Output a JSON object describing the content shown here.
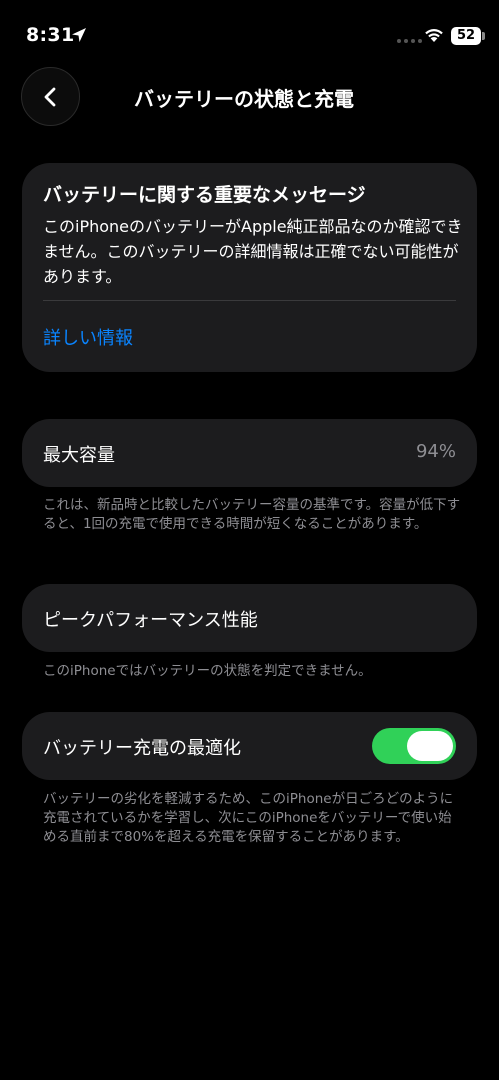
{
  "status_bar": {
    "time": "8:31",
    "battery_level": "52",
    "icons": [
      "location-arrow-icon",
      "signal-dots-icon",
      "wifi-icon",
      "battery-icon"
    ]
  },
  "nav": {
    "title": "バッテリーの状態と充電",
    "back_icon": "chevron-left-icon"
  },
  "message_card": {
    "title": "バッテリーに関する重要なメッセージ",
    "body": "このiPhoneのバッテリーがApple純正部品なのか確認できません。このバッテリーの詳細情報は正確でない可能性があります。",
    "link": "詳しい情報"
  },
  "max_capacity": {
    "label": "最大容量",
    "value": "94%",
    "note": "これは、新品時と比較したバッテリー容量の基準です。容量が低下すると、1回の充電で使用できる時間が短くなることがあります。"
  },
  "peak_performance": {
    "label": "ピークパフォーマンス性能",
    "note": "このiPhoneではバッテリーの状態を判定できません。"
  },
  "optimized_charging": {
    "label": "バッテリー充電の最適化",
    "enabled": true,
    "note": "バッテリーの劣化を軽減するため、このiPhoneが日ごろどのように充電されているかを学習し、次にこのiPhoneをバッテリーで使い始める直前まで80%を超える充電を保留することがあります。"
  },
  "colors": {
    "background": "#000000",
    "card": "#1c1c1e",
    "link": "#0a84ff",
    "toggle_on": "#30d158",
    "secondary_text": "#8e8e93"
  }
}
